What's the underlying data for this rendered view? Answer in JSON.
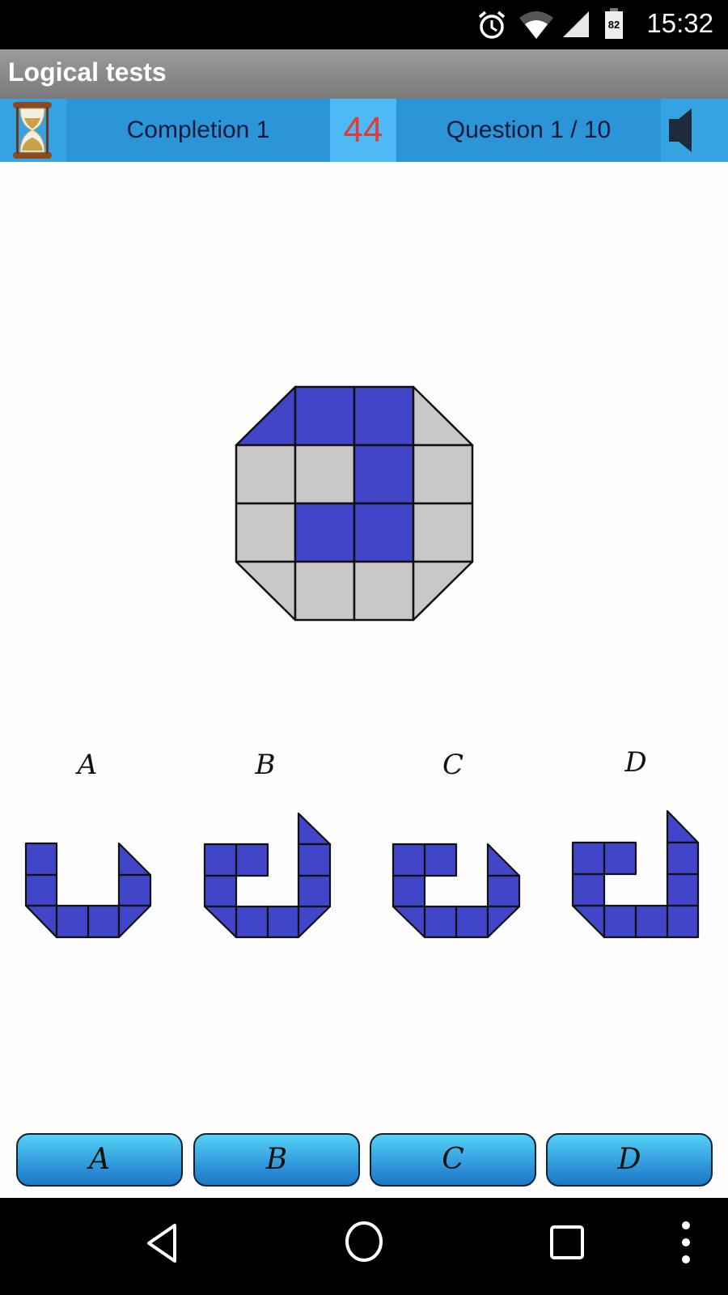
{
  "status_bar": {
    "time": "15:32",
    "battery_level": "82",
    "icons": [
      "alarm-icon",
      "wifi-icon",
      "cell-signal-icon",
      "battery-icon"
    ]
  },
  "app": {
    "title": "Logical tests"
  },
  "info_bar": {
    "icon_left": "hourglass-icon",
    "test_name": "Completion 1",
    "timer": "44",
    "timer_color": "#e03a3a",
    "question_progress": "Question 1 / 10",
    "icon_right": "speaker-icon"
  },
  "puzzle": {
    "description": "Octagon 4x4 grid with triangulated corners; blue pieces form the missing pattern",
    "fill_color": "#4146c9",
    "empty_color": "#c8c8c8",
    "grid": [
      [
        "blue-triangle",
        "blue",
        "blue",
        "gray-triangle"
      ],
      [
        "gray",
        "gray",
        "blue",
        "gray"
      ],
      [
        "gray",
        "blue",
        "blue",
        "gray"
      ],
      [
        "gray-triangle",
        "gray",
        "gray",
        "gray-triangle"
      ]
    ]
  },
  "options": [
    {
      "label": "A"
    },
    {
      "label": "B"
    },
    {
      "label": "C"
    },
    {
      "label": "D"
    }
  ],
  "answer_buttons": [
    {
      "label": "A"
    },
    {
      "label": "B"
    },
    {
      "label": "C"
    },
    {
      "label": "D"
    }
  ],
  "nav_bar": {
    "buttons": [
      "back-icon",
      "home-icon",
      "recents-icon",
      "menu-icon"
    ]
  }
}
